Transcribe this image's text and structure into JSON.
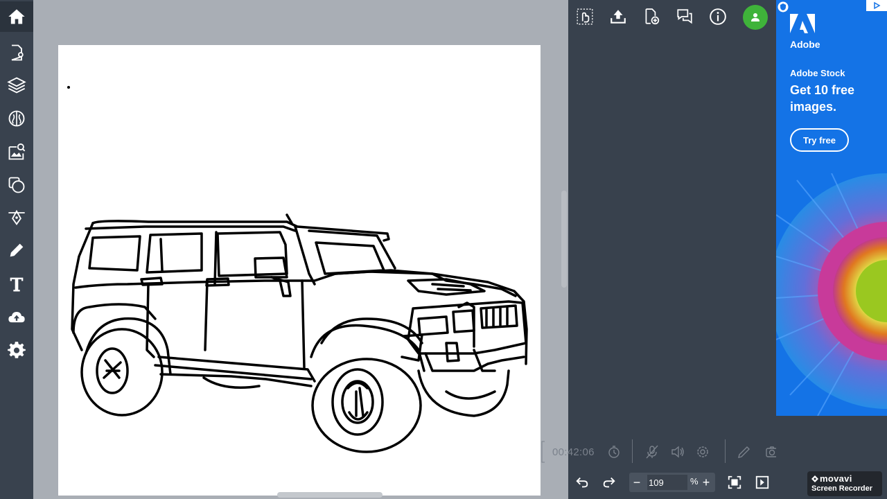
{
  "left_toolbar": {
    "items": [
      {
        "name": "home",
        "icon": "home-icon"
      },
      {
        "name": "page-settings",
        "icon": "page-settings-icon"
      },
      {
        "name": "layers",
        "icon": "layers-icon"
      },
      {
        "name": "brain",
        "icon": "brain-icon"
      },
      {
        "name": "image-search",
        "icon": "image-search-icon"
      },
      {
        "name": "shapes",
        "icon": "shapes-icon"
      },
      {
        "name": "vector",
        "icon": "vector-pen-icon"
      },
      {
        "name": "draw",
        "icon": "pencil-icon"
      },
      {
        "name": "text",
        "icon": "text-icon"
      },
      {
        "name": "upload",
        "icon": "cloud-upload-icon"
      },
      {
        "name": "settings",
        "icon": "gear-icon"
      }
    ]
  },
  "top_icons": [
    "hand-touch-icon",
    "export-icon",
    "add-page-icon",
    "comments-icon",
    "info-icon",
    "user-avatar-icon"
  ],
  "recorder": {
    "time": "00:42:06"
  },
  "zoom": {
    "value": "109",
    "unit": "%",
    "minus": "−",
    "plus": "+"
  },
  "ad": {
    "brand": "Adobe",
    "product": "Adobe Stock",
    "headline": "Get 10 free images.",
    "cta": "Try free"
  },
  "watermark": {
    "name": "movavi",
    "sub": "Screen Recorder"
  },
  "colors": {
    "sidebar": "#39424e",
    "panel": "#38414d",
    "workspace": "#a9aeb5",
    "avatar": "#3fb33a",
    "ad": "#1473e6"
  }
}
